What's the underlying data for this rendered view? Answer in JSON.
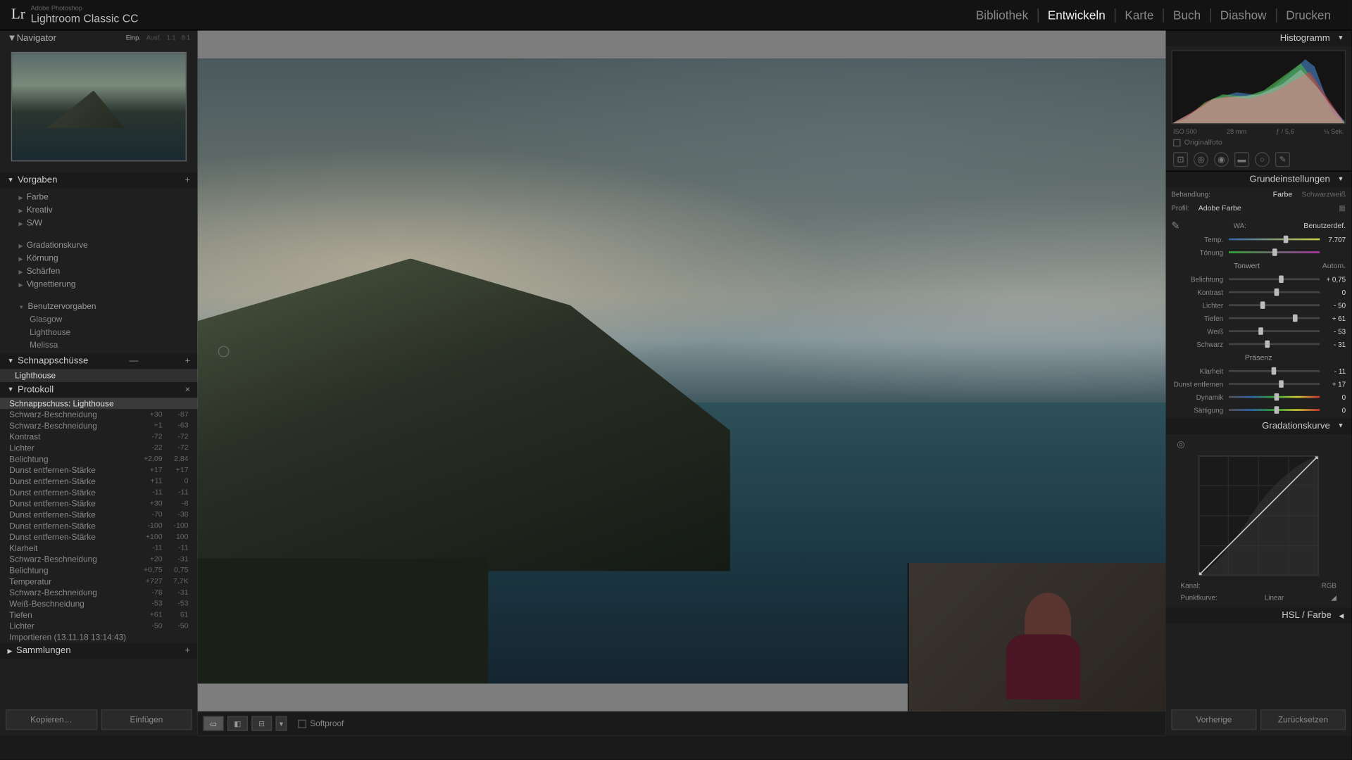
{
  "app": {
    "subtitle": "Adobe Photoshop",
    "title": "Lightroom Classic CC"
  },
  "modules": [
    "Bibliothek",
    "Entwickeln",
    "Karte",
    "Buch",
    "Diashow",
    "Drucken"
  ],
  "activeModule": 1,
  "navigator": {
    "title": "Navigator",
    "zoom": [
      "Einp.",
      "Ausf.",
      "1:1",
      "8:1"
    ]
  },
  "presets": {
    "title": "Vorgaben",
    "groups": [
      "Farbe",
      "Kreativ",
      "S/W"
    ],
    "groups2": [
      "Gradationskurve",
      "Körnung",
      "Schärfen",
      "Vignettierung"
    ],
    "userTitle": "Benutzervorgaben",
    "user": [
      "Glasgow",
      "Lighthouse",
      "Melissa"
    ]
  },
  "snapshots": {
    "title": "Schnappschüsse",
    "items": [
      "Lighthouse"
    ]
  },
  "history": {
    "title": "Protokoll",
    "rows": [
      {
        "n": "Schnappschuss: Lighthouse",
        "a": "",
        "b": "",
        "sel": true
      },
      {
        "n": "Schwarz-Beschneidung",
        "a": "+30",
        "b": "-87"
      },
      {
        "n": "Schwarz-Beschneidung",
        "a": "+1",
        "b": "-63"
      },
      {
        "n": "Kontrast",
        "a": "-72",
        "b": "-72"
      },
      {
        "n": "Lichter",
        "a": "-22",
        "b": "-72"
      },
      {
        "n": "Belichtung",
        "a": "+2,09",
        "b": "2,84"
      },
      {
        "n": "Dunst entfernen-Stärke",
        "a": "+17",
        "b": "+17"
      },
      {
        "n": "Dunst entfernen-Stärke",
        "a": "+11",
        "b": "0"
      },
      {
        "n": "Dunst entfernen-Stärke",
        "a": "-11",
        "b": "-11"
      },
      {
        "n": "Dunst entfernen-Stärke",
        "a": "+30",
        "b": "-8"
      },
      {
        "n": "Dunst entfernen-Stärke",
        "a": "-70",
        "b": "-38"
      },
      {
        "n": "Dunst entfernen-Stärke",
        "a": "-100",
        "b": "-100"
      },
      {
        "n": "Dunst entfernen-Stärke",
        "a": "+100",
        "b": "100"
      },
      {
        "n": "Klarheit",
        "a": "-11",
        "b": "-11"
      },
      {
        "n": "Schwarz-Beschneidung",
        "a": "+20",
        "b": "-31"
      },
      {
        "n": "Belichtung",
        "a": "+0,75",
        "b": "0,75"
      },
      {
        "n": "Temperatur",
        "a": "+727",
        "b": "7,7K"
      },
      {
        "n": "Schwarz-Beschneidung",
        "a": "-78",
        "b": "-31"
      },
      {
        "n": "Weiß-Beschneidung",
        "a": "-53",
        "b": "-53"
      },
      {
        "n": "Tiefen",
        "a": "+61",
        "b": "61"
      },
      {
        "n": "Lichter",
        "a": "-50",
        "b": "-50"
      },
      {
        "n": "Importieren (13.11.18 13:14:43)",
        "a": "",
        "b": ""
      }
    ]
  },
  "collections": {
    "title": "Sammlungen"
  },
  "leftButtons": {
    "copy": "Kopieren…",
    "paste": "Einfügen"
  },
  "toolbar": {
    "softproof": "Softproof"
  },
  "histogram": {
    "title": "Histogramm",
    "iso": "ISO 500",
    "focal": "28 mm",
    "aperture": "ƒ / 5,6",
    "shutter": "⅛ Sek.",
    "original": "Originalfoto"
  },
  "basic": {
    "title": "Grundeinstellungen",
    "treatment": {
      "label": "Behandlung:",
      "color": "Farbe",
      "bw": "Schwarzweiß"
    },
    "profile": {
      "label": "Profil:",
      "value": "Adobe Farbe"
    },
    "wb": {
      "label": "WA:",
      "value": "Benutzerdef."
    },
    "sliders": [
      {
        "l": "Temp.",
        "v": "7.707",
        "p": 60
      },
      {
        "l": "Tönung",
        "v": "",
        "p": 48
      }
    ],
    "tone": {
      "title": "Tonwert",
      "auto": "Autom."
    },
    "toneSliders": [
      {
        "l": "Belichtung",
        "v": "+ 0,75",
        "p": 55
      },
      {
        "l": "Kontrast",
        "v": "0",
        "p": 50
      },
      {
        "l": "Lichter",
        "v": "- 50",
        "p": 35
      },
      {
        "l": "Tiefen",
        "v": "+ 61",
        "p": 70
      },
      {
        "l": "Weiß",
        "v": "- 53",
        "p": 33
      },
      {
        "l": "Schwarz",
        "v": "- 31",
        "p": 40
      }
    ],
    "presence": {
      "title": "Präsenz"
    },
    "presenceSliders": [
      {
        "l": "Klarheit",
        "v": "- 11",
        "p": 47
      },
      {
        "l": "Dunst entfernen",
        "v": "+ 17",
        "p": 55
      },
      {
        "l": "Dynamik",
        "v": "0",
        "p": 50
      },
      {
        "l": "Sättigung",
        "v": "0",
        "p": 50
      }
    ]
  },
  "tonecurve": {
    "title": "Gradationskurve",
    "channel": {
      "label": "Kanal:",
      "value": "RGB"
    },
    "point": {
      "label": "Punktkurve:",
      "value": "Linear"
    }
  },
  "hsl": {
    "title": "HSL / Farbe"
  },
  "rightButtons": {
    "prev": "Vorherige",
    "reset": "Zurücksetzen"
  }
}
